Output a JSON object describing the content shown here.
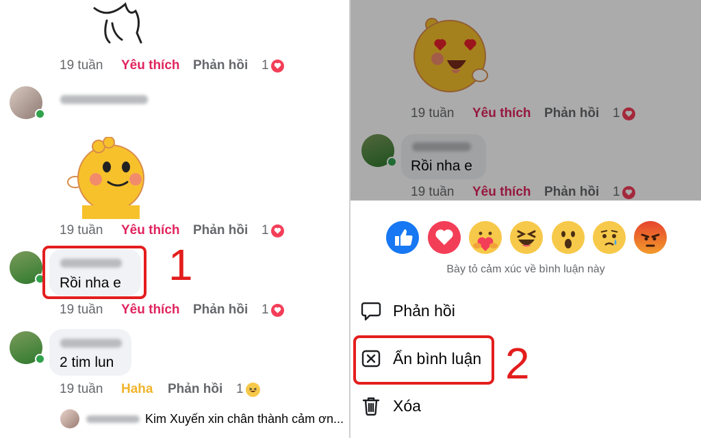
{
  "left": {
    "comments": [
      {
        "time": "19 tuần",
        "like": "Yêu thích",
        "reply": "Phản hồi",
        "count": "1"
      },
      {
        "author": "Hoàng Gia Hân",
        "time": "19 tuần",
        "like": "Yêu thích",
        "reply": "Phản hồi",
        "count": "1"
      },
      {
        "author": "Kim Xuyến",
        "text": "Rồi nha e",
        "time": "19 tuần",
        "like": "Yêu thích",
        "reply": "Phản hồi",
        "count": "1"
      },
      {
        "author": "Kim Xuyến",
        "text": "2 tim lun",
        "time": "19 tuần",
        "like": "Haha",
        "reply": "Phản hồi",
        "count": "1"
      }
    ],
    "reply_preview": {
      "author": "Khánh Vy",
      "text": "Kim Xuyến xin chân thành cảm ơn..."
    },
    "step_number": "1"
  },
  "right": {
    "comments": [
      {
        "time": "19 tuần",
        "like": "Yêu thích",
        "reply": "Phản hồi",
        "count": "1"
      },
      {
        "author": "Kim Xuyến",
        "text": "Rồi nha e",
        "time": "19 tuần",
        "like": "Yêu thích",
        "reply": "Phản hồi",
        "count": "1"
      }
    ],
    "sheet": {
      "reactions": [
        "like-icon",
        "love-icon",
        "care-icon",
        "haha-icon",
        "wow-icon",
        "sad-icon",
        "angry-icon"
      ],
      "reaction_caption": "Bày tỏ cảm xúc về bình luận này",
      "actions": [
        {
          "label": "Phản hồi",
          "icon": "speech-bubble-icon"
        },
        {
          "label": "Ẩn bình luận",
          "icon": "close-box-icon"
        },
        {
          "label": "Xóa",
          "icon": "trash-icon"
        }
      ]
    },
    "step_number": "2"
  },
  "colors": {
    "like_red": "#e0245e",
    "haha_yellow": "#f0b429",
    "annotation_red": "#e31d1d",
    "facebook_blue": "#1877f2"
  }
}
